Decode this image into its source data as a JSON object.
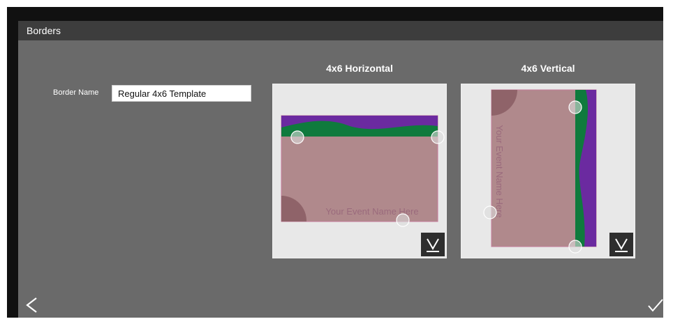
{
  "header": {
    "title": "Borders"
  },
  "form": {
    "border_name_label": "Border Name",
    "border_name_value": "Regular 4x6 Template"
  },
  "templates": [
    {
      "title": "4x6 Horizontal",
      "event_text": "Your Event Name Here"
    },
    {
      "title": "4x6 Vertical",
      "event_text": "Your Event Name Here"
    }
  ],
  "colors": {
    "header_bg": "#3d3d3d",
    "content_bg": "#6a6a6a",
    "card_bg": "#e8e8e8",
    "photo_area": "#b0898c",
    "purple": "#6b2aa0",
    "green": "#0f7a3d",
    "event_text": "#9a6a7c"
  },
  "icons": {
    "back": "chevron-left-icon",
    "confirm": "checkmark-icon",
    "download": "download-icon"
  }
}
